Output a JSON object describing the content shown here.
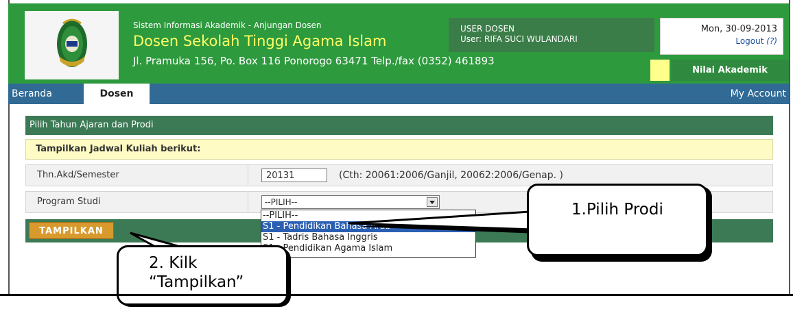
{
  "header": {
    "subtitle": "Sistem Informasi Akademik - Anjungan Dosen",
    "title": "Dosen Sekolah Tinggi Agama Islam",
    "address": "Jl. Pramuka 156, Po. Box 116 Ponorogo 63471 Telp./fax (0352) 461893",
    "user_role": "USER DOSEN",
    "user_name": "User: RIFA SUCI WULANDARI",
    "date": "Mon, 30-09-2013",
    "logout_label": "Logout",
    "logout_help": "(?)",
    "nilai_button": "Nilai Akademik",
    "logo_icon": "college-emblem-icon"
  },
  "nav": {
    "home": "Beranda",
    "dosen": "Dosen",
    "account": "My Account"
  },
  "panel": {
    "title": "Pilih Tahun Ajaran dan Prodi",
    "form_heading": "Tampilkan Jadwal Kuliah berikut:",
    "semester_label": "Thn.Akd/Semester",
    "semester_value": "20131",
    "semester_hint": "(Cth: 20061:2006/Ganjil, 20062:2006/Genap. )",
    "prodi_label": "Program Studi",
    "prodi_selected": "--PILIH--",
    "prodi_options": [
      "--PILIH--",
      "S1 - Pendidikan Bahasa Arab",
      "S1 - Tadris Bahasa Inggris",
      "S1 - Pendidikan Agama Islam"
    ],
    "button": "TAMPILKAN"
  },
  "annotations": {
    "step1": "1.Pilih Prodi",
    "step2_line1": "2. Kilk",
    "step2_line2": "“Tampilkan”"
  },
  "colors": {
    "header_green": "#2e9a3e",
    "nav_blue": "#306a95",
    "panel_green": "#3c7a55",
    "title_yellow": "#ffff66",
    "button_orange": "#d89a2c",
    "selected_option": "#2b5fb3"
  }
}
